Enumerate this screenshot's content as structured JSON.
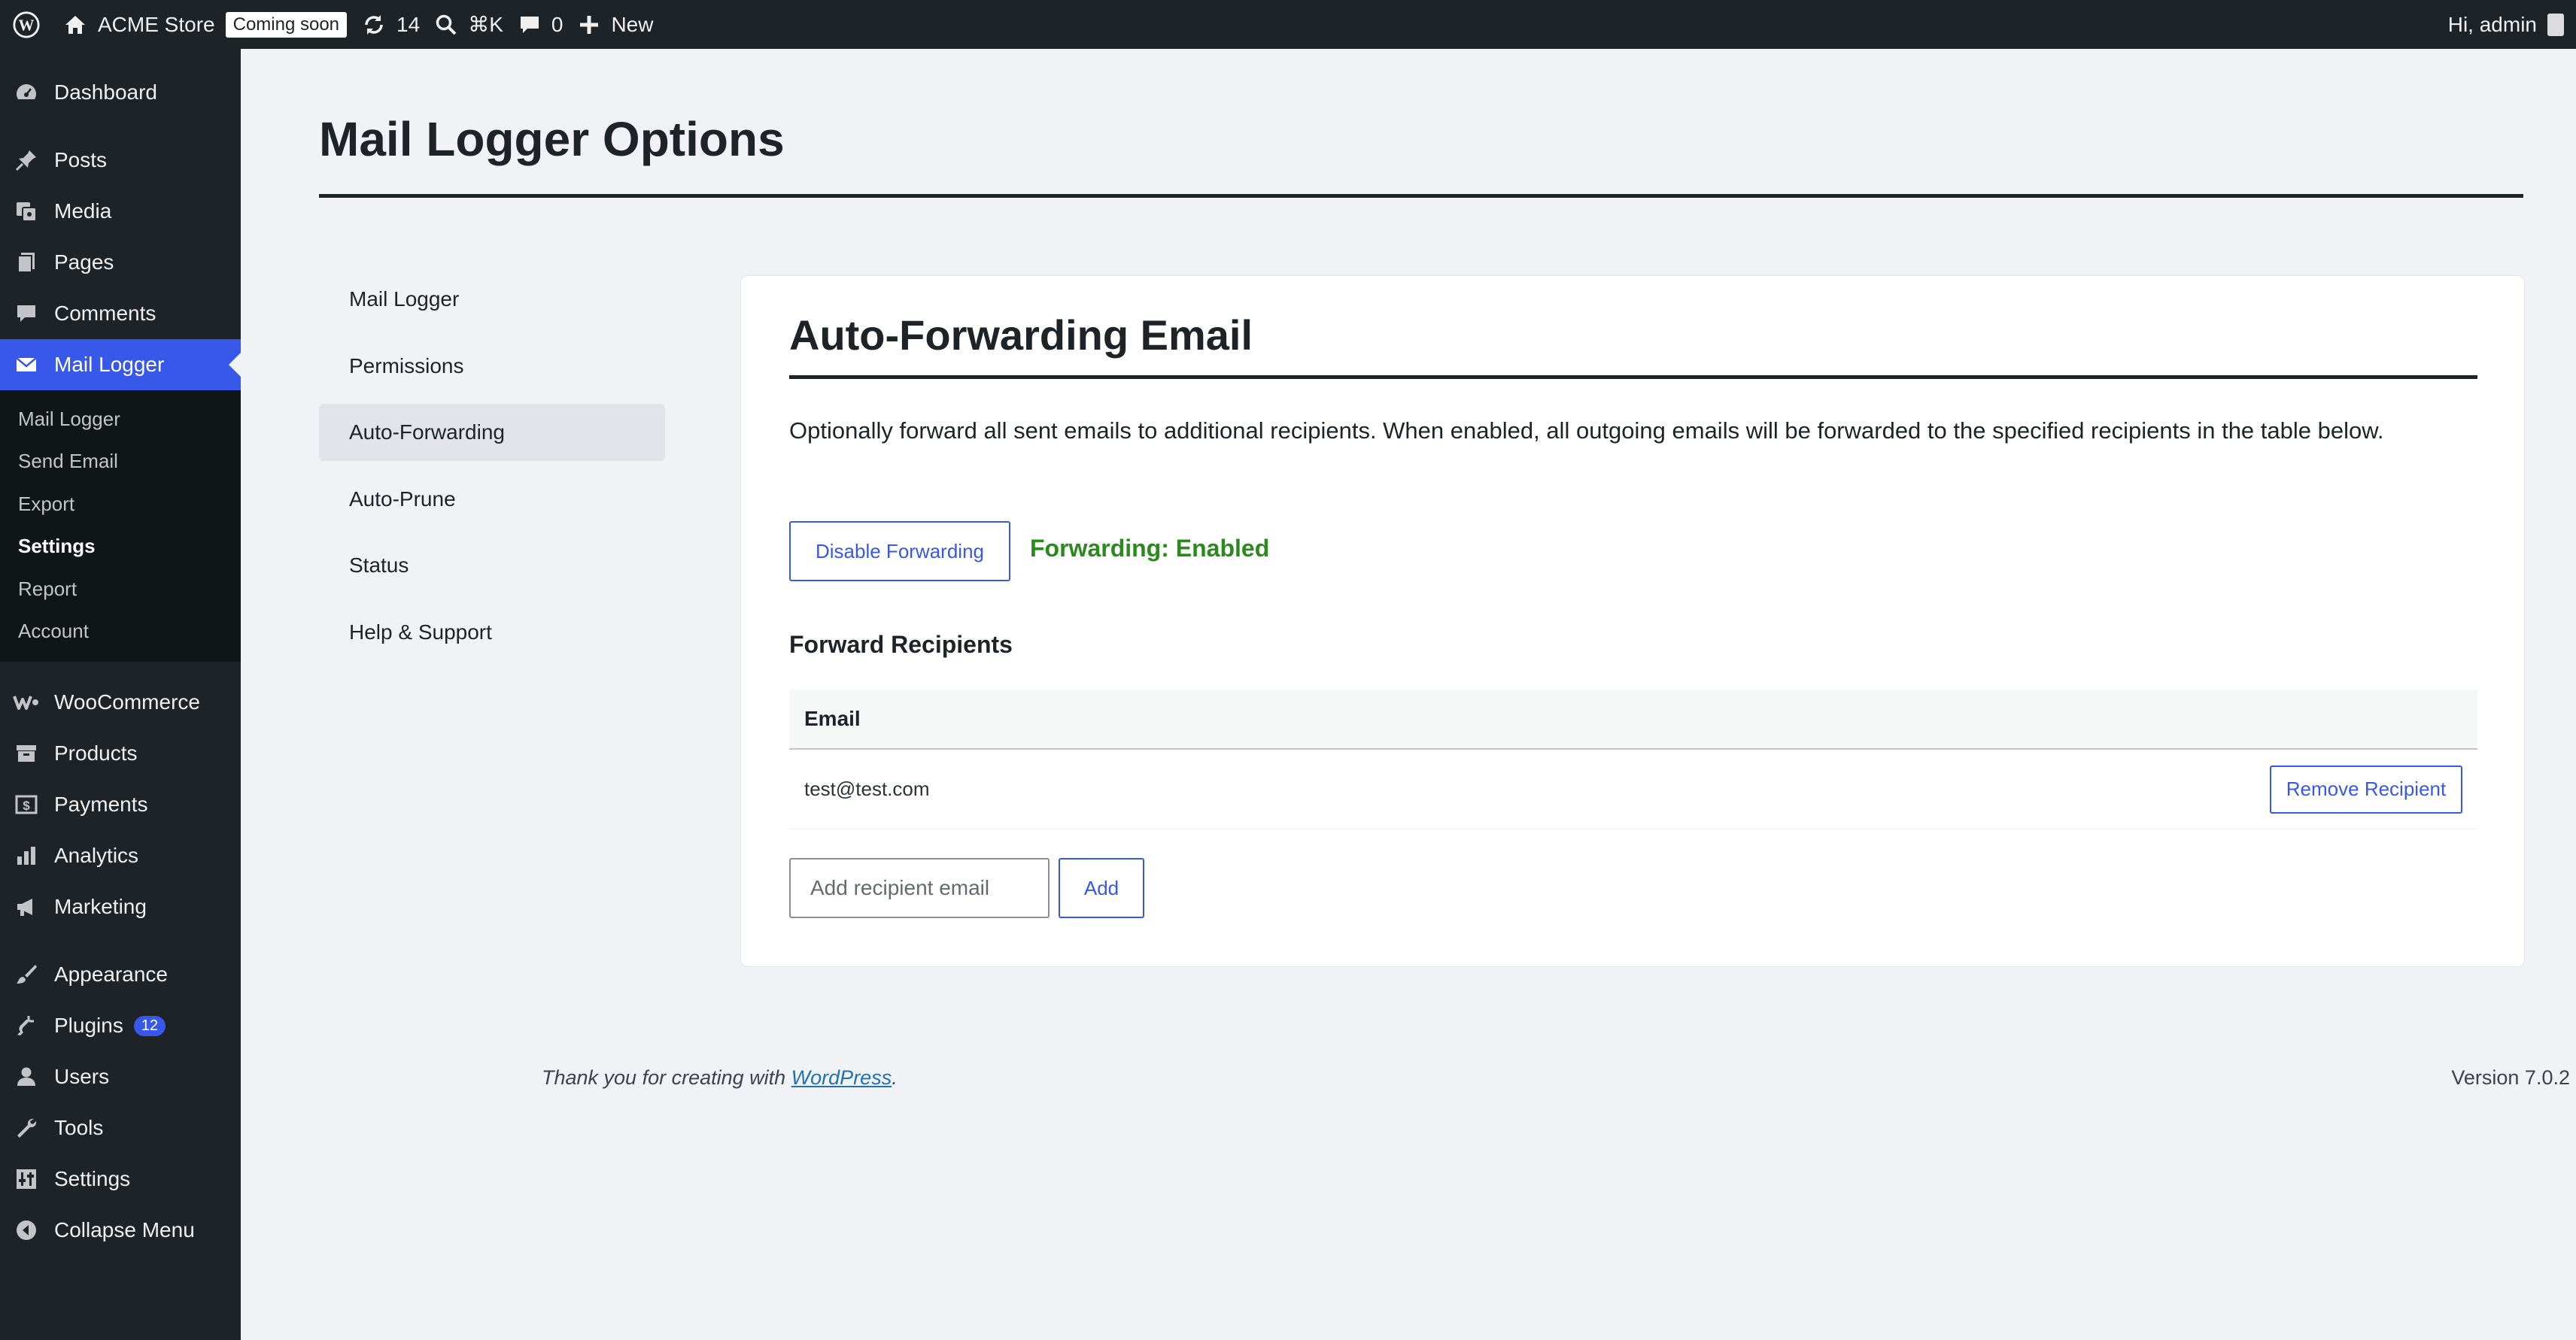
{
  "adminbar": {
    "site_name": "ACME Store",
    "coming_soon": "Coming soon",
    "updates_count": "14",
    "search_shortcut": "⌘K",
    "comments_count": "0",
    "new_label": "New",
    "greeting": "Hi, admin"
  },
  "sidebar": {
    "dashboard": "Dashboard",
    "posts": "Posts",
    "media": "Media",
    "pages": "Pages",
    "comments": "Comments",
    "mail_logger": "Mail Logger",
    "submenu": [
      "Mail Logger",
      "Send Email",
      "Export",
      "Settings",
      "Report",
      "Account"
    ],
    "woocommerce": "WooCommerce",
    "products": "Products",
    "payments": "Payments",
    "analytics": "Analytics",
    "marketing": "Marketing",
    "appearance": "Appearance",
    "plugins": "Plugins",
    "plugins_count": "12",
    "users": "Users",
    "tools": "Tools",
    "settings": "Settings",
    "collapse": "Collapse Menu"
  },
  "page": {
    "title": "Mail Logger Options"
  },
  "settings_nav": [
    "Mail Logger",
    "Permissions",
    "Auto-Forwarding",
    "Auto-Prune",
    "Status",
    "Help & Support"
  ],
  "panel": {
    "title": "Auto-Forwarding Email",
    "description": "Optionally forward all sent emails to additional recipients. When enabled, all outgoing emails will be forwarded to the specified recipients in the table below.",
    "disable_button": "Disable Forwarding",
    "status": "Forwarding: Enabled",
    "recipients_heading": "Forward Recipients",
    "table_header": "Email",
    "recipients": [
      {
        "email": "test@test.com",
        "remove_label": "Remove Recipient"
      }
    ],
    "input_placeholder": "Add recipient email",
    "add_button": "Add"
  },
  "footer": {
    "thanks_prefix": "Thank you for creating with ",
    "thanks_link": "WordPress",
    "thanks_suffix": ".",
    "version": "Version 7.0.2"
  },
  "colors": {
    "accent": "#3858e9",
    "adminbar_bg": "#1d2327",
    "status_green": "#2a8a1c"
  },
  "icons": [
    "wordpress-logo-icon",
    "home-icon",
    "updates-icon",
    "search-icon",
    "comment-icon",
    "plus-icon"
  ]
}
